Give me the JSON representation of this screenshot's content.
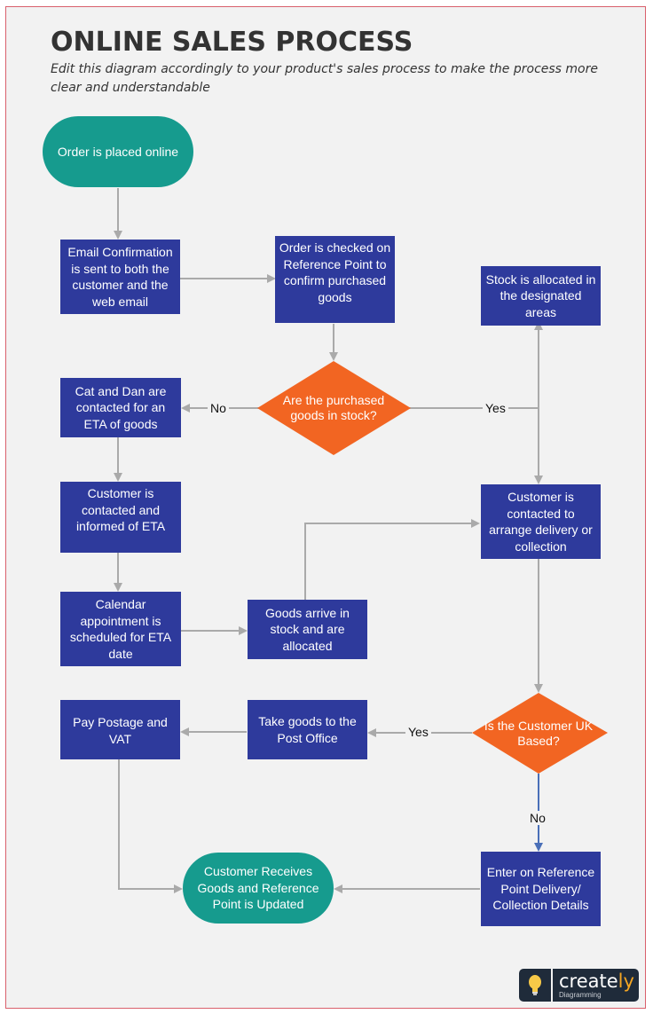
{
  "header": {
    "title": "ONLINE SALES PROCESS",
    "subtitle": "Edit this diagram accordingly to your product's sales process to make the process more clear and understandable"
  },
  "colors": {
    "process": "#2e3a9c",
    "terminal": "#169b8e",
    "decision": "#f26522",
    "connector": "#aaaaaa",
    "connector_no": "#4a6fb8",
    "frame_border": "#d9606c",
    "background": "#f2f2f2"
  },
  "nodes": {
    "order_placed": "Order is placed online",
    "email_confirmation": "Email Confirmation is sent to both the customer and the web email",
    "order_checked": "Order is checked on Reference Point to confirm purchased goods",
    "stock_allocated": "Stock is allocated in the designated areas",
    "in_stock_decision": "Are the purchased goods  in stock?",
    "cat_dan": "Cat and Dan are contacted for an ETA of goods",
    "customer_informed_eta": "Customer is contacted and informed of ETA",
    "calendar_appointment": "Calendar appointment is scheduled for ETA date",
    "goods_arrive": "Goods arrive in stock and are allocated",
    "arrange_delivery": "Customer is contacted to arrange delivery or collection",
    "uk_decision": "Is the Customer  UK Based?",
    "pay_postage": "Pay Postage and VAT",
    "post_office": "Take goods to the Post Office",
    "enter_reference": "Enter on Reference Point Delivery/ Collection Details",
    "customer_receives": "Customer Receives Goods and Reference Point is Updated"
  },
  "edge_labels": {
    "stock_no": "No",
    "stock_yes": "Yes",
    "uk_yes": "Yes",
    "uk_no": "No"
  },
  "logo": {
    "brand_main": "create",
    "brand_accent": "ly",
    "tagline": "Diagramming",
    "icon": "lightbulb-icon"
  }
}
